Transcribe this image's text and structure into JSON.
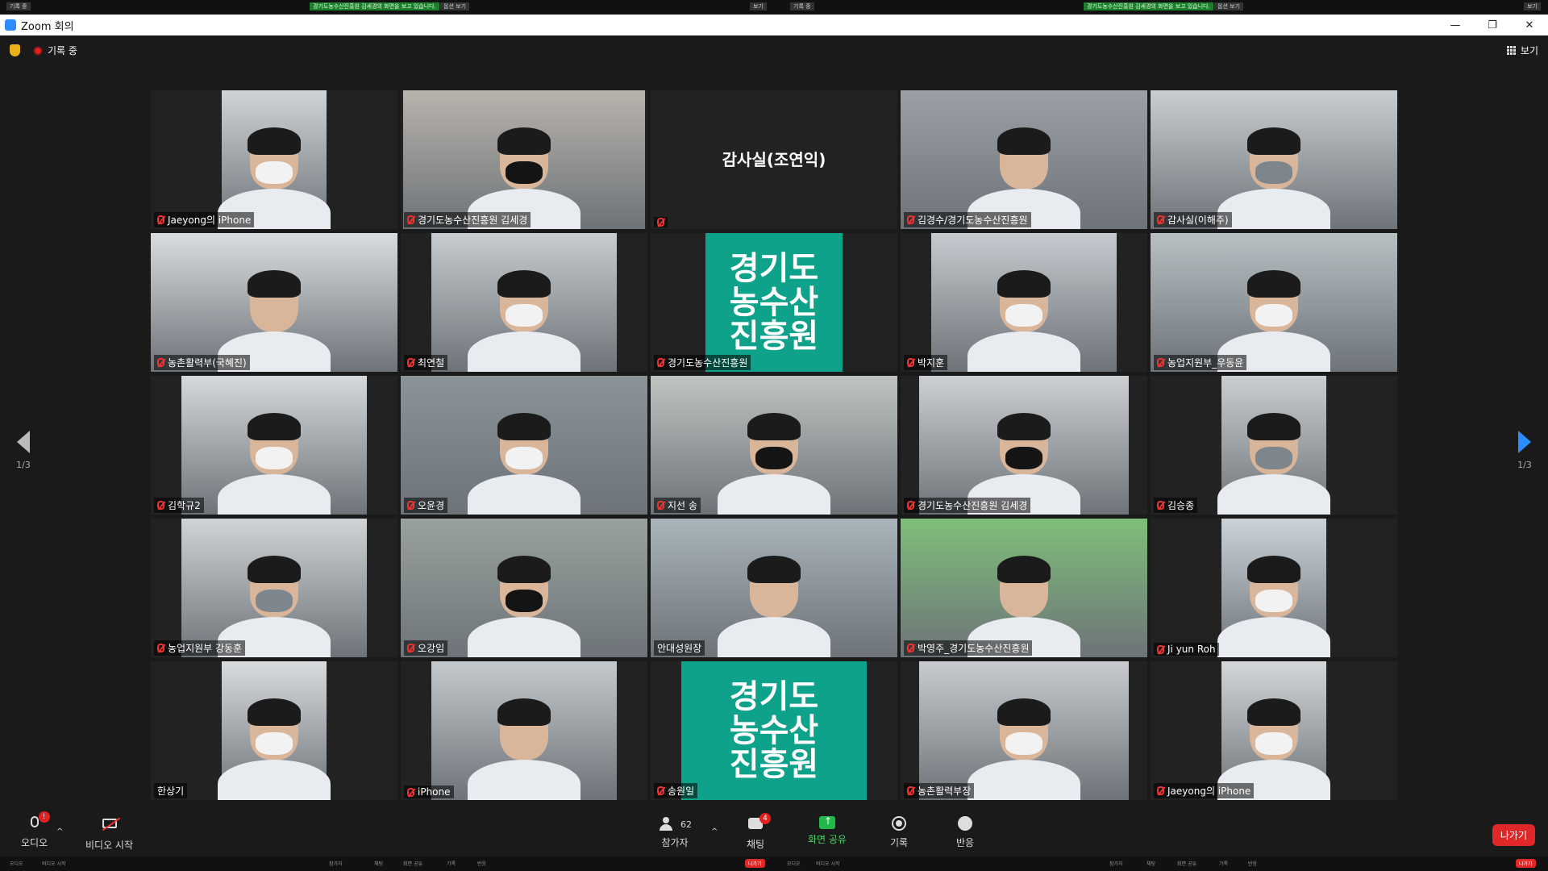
{
  "window": {
    "title": "Zoom 회의"
  },
  "topstrip": {
    "share_notice": "경기도농수산진흥원 김세경의 화면을 보고 있습니다.",
    "view_option": "옵션 보기",
    "rec_text": "기록 중",
    "view_text": "보기"
  },
  "status": {
    "recording": "기록 중",
    "view": "보기"
  },
  "pager": {
    "left": "1/3",
    "right": "1/3"
  },
  "tiles": [
    {
      "name": "Jaeyong의 iPhone",
      "muted": true
    },
    {
      "name": "경기도농수산진흥원 김세경",
      "muted": true
    },
    {
      "name": "감사실(조연익)",
      "muted": true,
      "name_only": true
    },
    {
      "name": "김경수/경기도농수산진흥원",
      "muted": true
    },
    {
      "name": "감사실(이해주)",
      "muted": true
    },
    {
      "name": "농촌활력부(국혜진)",
      "muted": true
    },
    {
      "name": "최연철",
      "muted": true
    },
    {
      "name": "경기도농수산진흥원",
      "muted": true,
      "logo": true
    },
    {
      "name": "박지훈",
      "muted": true
    },
    {
      "name": "농업지원부_우동윤",
      "muted": true
    },
    {
      "name": "김학규2",
      "muted": true
    },
    {
      "name": "오윤경",
      "muted": true
    },
    {
      "name": "지선 송",
      "muted": true
    },
    {
      "name": "경기도농수산진흥원 김세경",
      "muted": true
    },
    {
      "name": "김승종",
      "muted": true
    },
    {
      "name": "농업지원부 강동훈",
      "muted": true
    },
    {
      "name": "오강임",
      "muted": true
    },
    {
      "name": "안대성원장",
      "muted": false,
      "speaking": true
    },
    {
      "name": "박영주_경기도농수산진흥원",
      "muted": true
    },
    {
      "name": "Ji yun Roh",
      "muted": true
    },
    {
      "name": "한상기",
      "muted": false
    },
    {
      "name": "iPhone",
      "muted": true
    },
    {
      "name": "송원일",
      "muted": true,
      "logo": true
    },
    {
      "name": "농촌활력부장",
      "muted": true
    },
    {
      "name": "Jaeyong의 iPhone",
      "muted": true
    }
  ],
  "logo_text": [
    "경기도",
    "농수산",
    "진흥원"
  ],
  "toolbar": {
    "audio": "오디오",
    "audio_badge": "!",
    "video": "비디오 시작",
    "participants": "참가자",
    "participants_count": "62",
    "chat": "채팅",
    "chat_badge": "4",
    "share": "화면 공유",
    "record": "기록",
    "reactions": "반응",
    "leave": "나가기"
  },
  "bottomstrip": {
    "audio": "오디오",
    "video": "비디오 시작",
    "participants": "참가자",
    "chat": "채팅",
    "share": "화면 공유",
    "record": "기록",
    "reactions": "반응",
    "leave": "나가기"
  }
}
